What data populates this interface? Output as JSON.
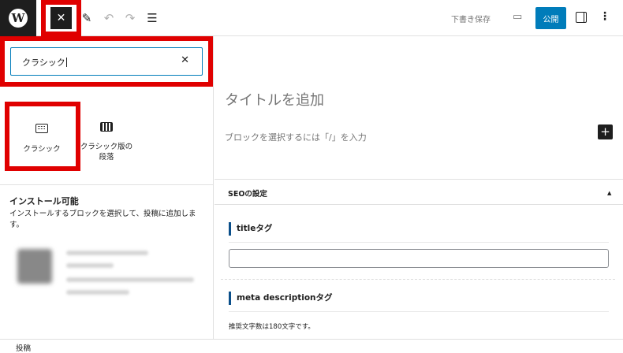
{
  "toolbar": {
    "logo_glyph": "W",
    "close_inserter_glyph": "✕",
    "tool_glyph": "✎",
    "undo_glyph": "↶",
    "redo_glyph": "↷",
    "list_view_glyph": "☰",
    "save_draft_label": "下書き保存",
    "preview_glyph": "▭",
    "publish_label": "公開",
    "options_glyph": "⋮",
    "icons": [
      "wordpress-logo-icon",
      "close-icon",
      "pencil-icon",
      "undo-icon",
      "redo-icon",
      "list-view-icon",
      "preview-icon",
      "settings-icon",
      "more-options-icon"
    ]
  },
  "inserter": {
    "search": {
      "value": "クラシック",
      "clear_glyph": "✕"
    },
    "results": [
      {
        "label": "クラシック",
        "icon": "keyboard-icon",
        "highlighted": true
      },
      {
        "label": "クラシック版の段落",
        "icon": "classic-paragraph-icon",
        "highlighted": false
      }
    ],
    "installable": {
      "title": "インストール可能",
      "description": "インストールするブロックを選択して、投稿に追加します。"
    }
  },
  "editor": {
    "title_placeholder": "タイトルを追加",
    "block_placeholder": "ブロックを選択するには「/」を入力",
    "add_block_glyph": "+"
  },
  "metabox": {
    "title": "SEOの設定",
    "toggle_glyph": "▲",
    "fields": [
      {
        "label": "titleタグ",
        "value": ""
      },
      {
        "label": "meta descriptionタグ",
        "hint": "推奨文字数は180文字です。"
      }
    ]
  },
  "footer": {
    "breadcrumb": "投稿"
  },
  "colors": {
    "accent": "#007cba",
    "highlight": "#e00000",
    "dark": "#1e1e1e",
    "field_marker": "#0b4f8a"
  }
}
